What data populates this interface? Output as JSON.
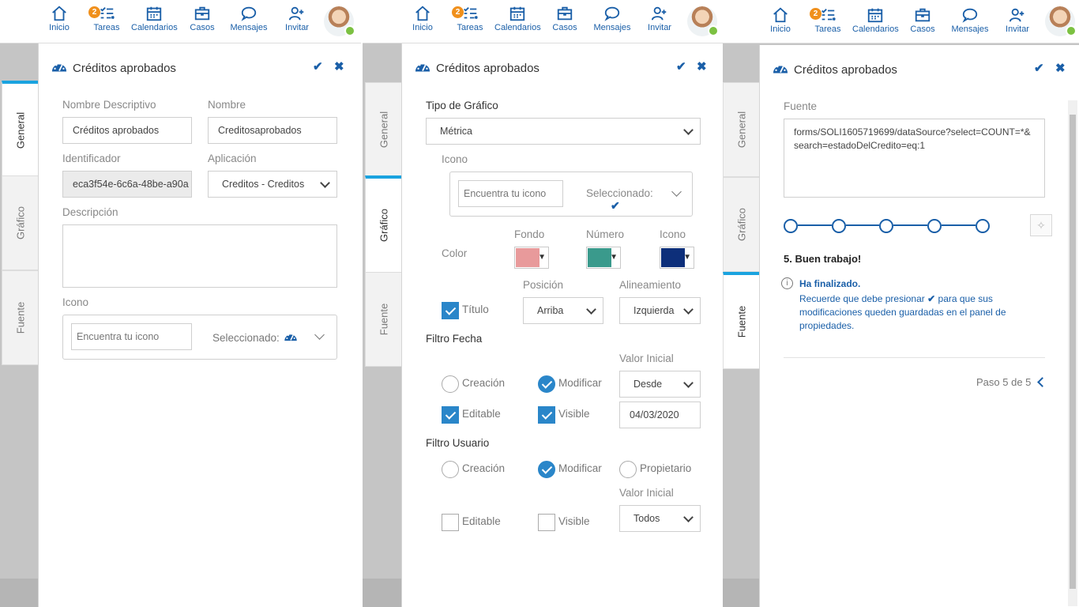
{
  "nav": {
    "items": [
      {
        "label": "Inicio",
        "icon": "home-icon"
      },
      {
        "label": "Tareas",
        "icon": "tasks-icon",
        "badge": "2"
      },
      {
        "label": "Calendarios",
        "icon": "calendar-icon"
      },
      {
        "label": "Casos",
        "icon": "briefcase-icon"
      },
      {
        "label": "Mensajes",
        "icon": "chat-icon"
      },
      {
        "label": "Invitar",
        "icon": "add-user-icon"
      }
    ],
    "status_color": "#7cc142",
    "badge_color": "#f0901c"
  },
  "panel_title": "Créditos aprobados",
  "tabs": {
    "general": "General",
    "grafico": "Gráfico",
    "fuente": "Fuente"
  },
  "accent_color": "#1aa3df",
  "general": {
    "nombre_descriptivo_label": "Nombre Descriptivo",
    "nombre_descriptivo_value": "Créditos aprobados",
    "nombre_label": "Nombre",
    "nombre_value": "Creditosaprobados",
    "identificador_label": "Identificador",
    "identificador_value": "eca3f54e-6c6a-48be-a90a",
    "aplicacion_label": "Aplicación",
    "aplicacion_value": "Creditos - Creditos",
    "descripcion_label": "Descripción",
    "icono_label": "Icono",
    "icono_placeholder": "Encuentra tu icono",
    "seleccionado_label": "Seleccionado:"
  },
  "grafico": {
    "tipo_label": "Tipo de Gráfico",
    "tipo_value": "Métrica",
    "icono_label": "Icono",
    "icono_placeholder": "Encuentra tu icono",
    "seleccionado_label": "Seleccionado:",
    "color_label": "Color",
    "fondo_label": "Fondo",
    "fondo_color": "#e89a9b",
    "numero_label": "Número",
    "numero_color": "#3a9a8c",
    "icono_color_label": "Icono",
    "icono_color": "#0d2f7a",
    "posicion_label": "Posición",
    "posicion_value": "Arriba",
    "alineamiento_label": "Alineamiento",
    "alineamiento_value": "Izquierda",
    "titulo_label": "Título",
    "filtro_fecha_label": "Filtro Fecha",
    "valor_inicial_label": "Valor Inicial",
    "creacion_label": "Creación",
    "modificar_label": "Modificar",
    "desde_value": "Desde",
    "editable_label": "Editable",
    "visible_label": "Visible",
    "fecha_value": "04/03/2020",
    "filtro_usuario_label": "Filtro Usuario",
    "propietario_label": "Propietario",
    "valor_inicial2_label": "Valor Inicial",
    "todos_value": "Todos"
  },
  "fuente": {
    "fuente_label": "Fuente",
    "fuente_value": "forms/SOLI1605719699/dataSource?select=COUNT=*&search=estadoDelCredito=eq:1",
    "step_title": "5. Buen trabajo!",
    "info_title": "Ha finalizado.",
    "info_text_1": "Recuerde que debe presionar",
    "info_text_2": "para que sus modificaciones queden guardadas en el panel de propiedades.",
    "paso_label": "Paso 5 de 5",
    "steps_total": 5,
    "steps_current": 5
  }
}
